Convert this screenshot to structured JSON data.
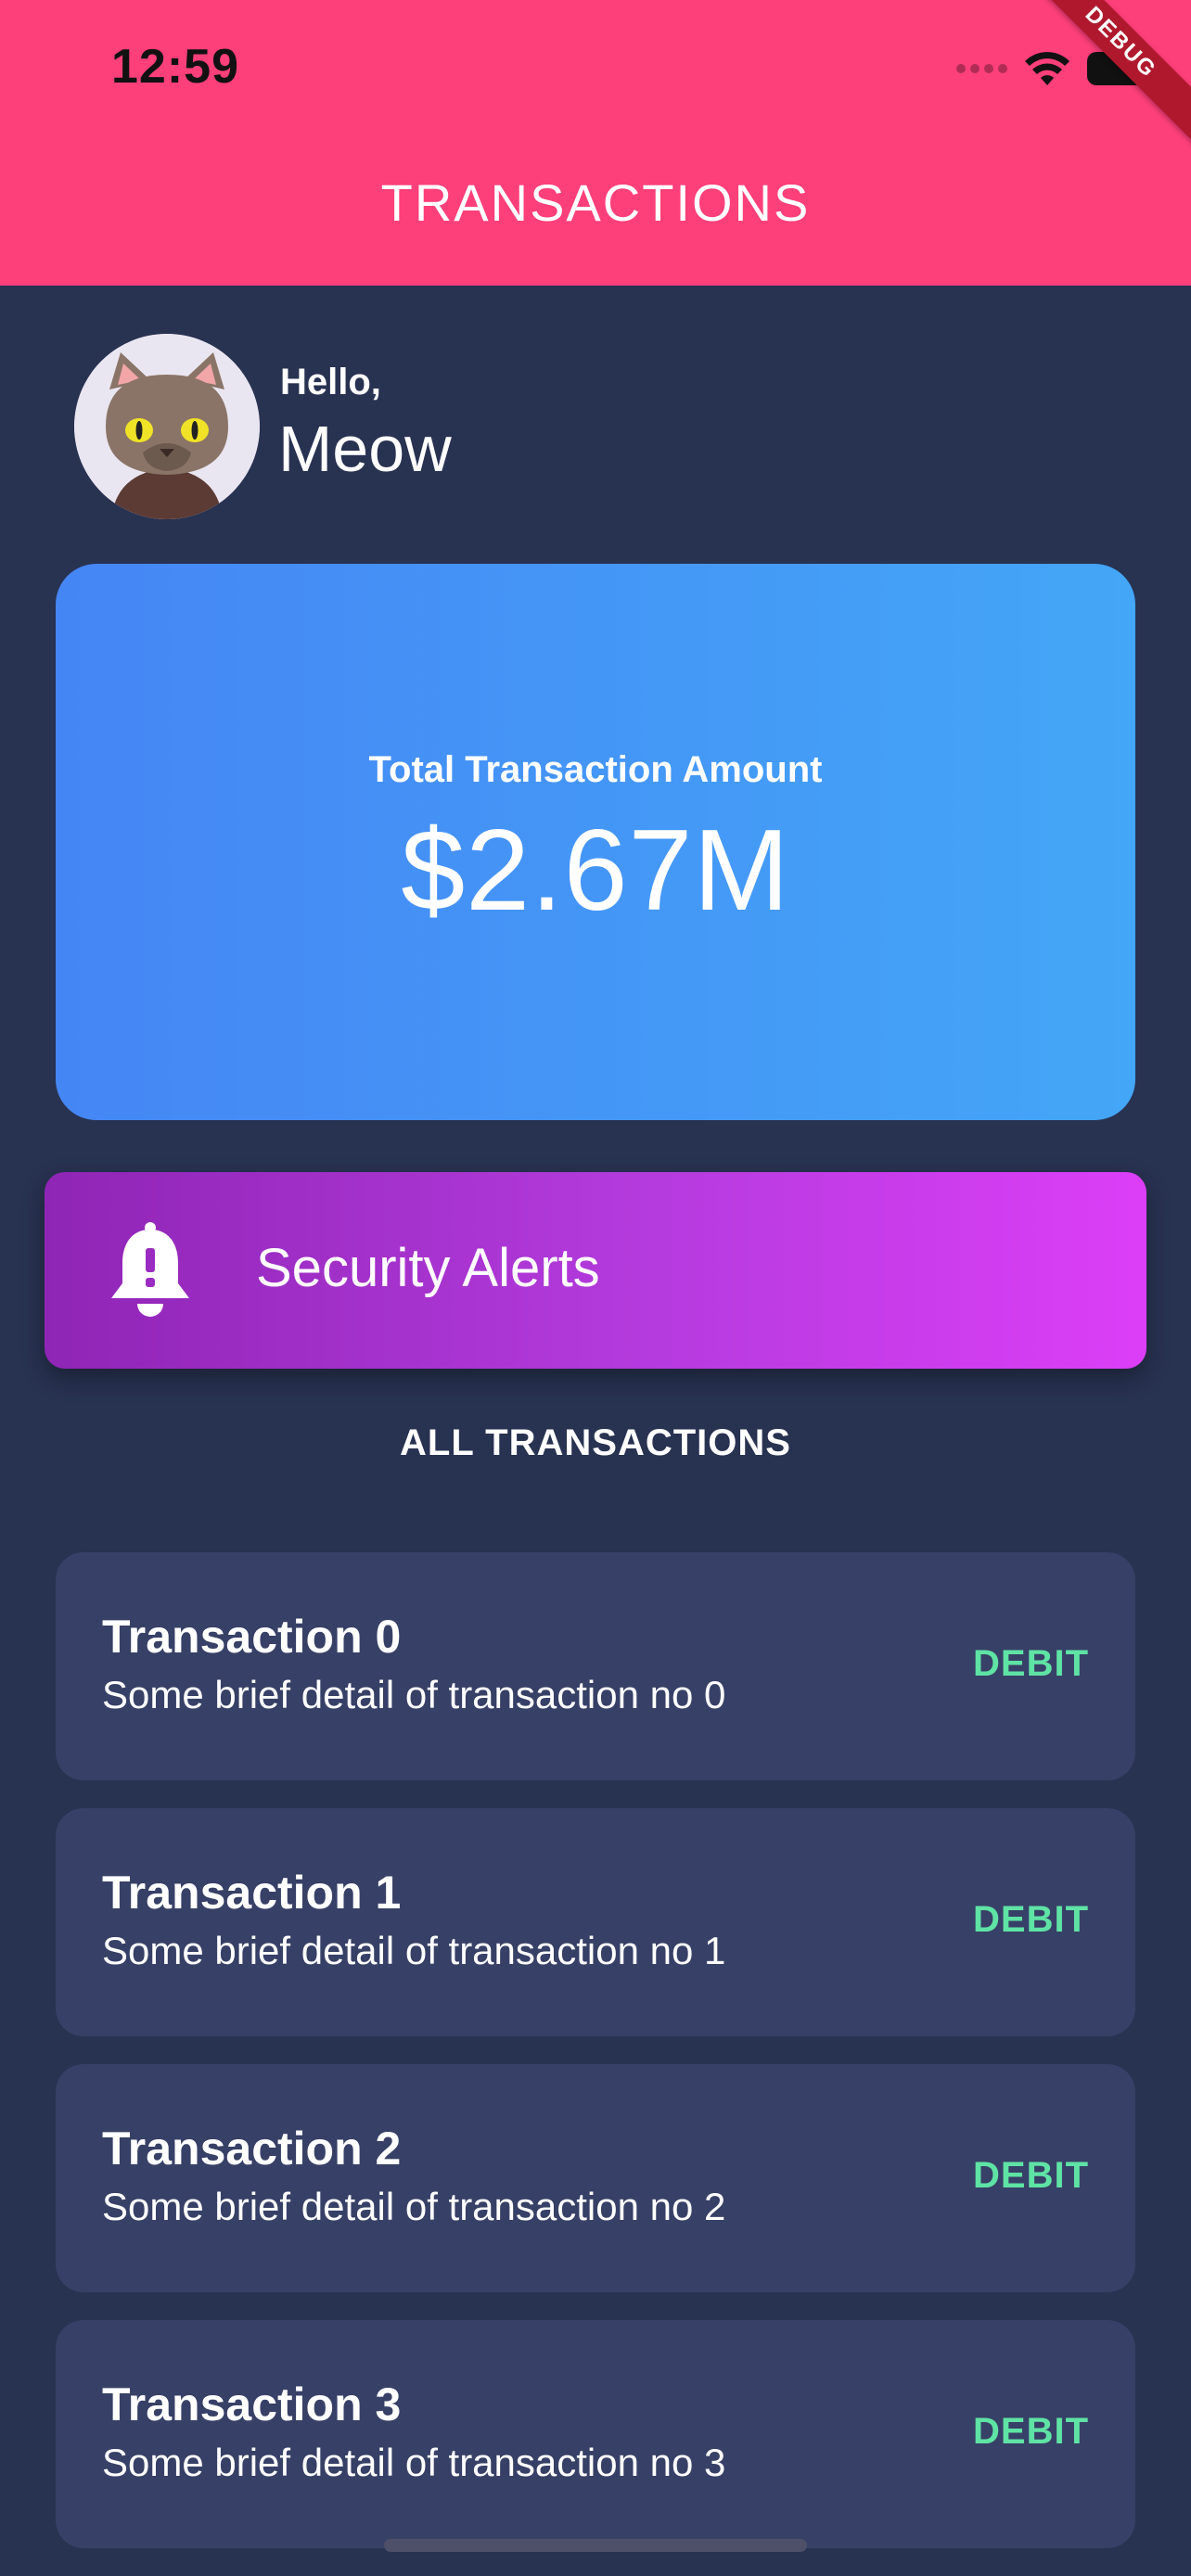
{
  "status_bar": {
    "time": "12:59",
    "debug_label": "DEBUG"
  },
  "app_bar": {
    "title": "TRANSACTIONS"
  },
  "greeting": {
    "hello": "Hello,",
    "name": "Meow"
  },
  "summary": {
    "label": "Total Transaction Amount",
    "amount": "$2.67M"
  },
  "alerts": {
    "label": "Security Alerts",
    "icon": "bell-alert-icon"
  },
  "section": {
    "title": "ALL TRANSACTIONS"
  },
  "transactions": [
    {
      "title": "Transaction 0",
      "detail": "Some brief detail of transaction no 0",
      "type": "DEBIT"
    },
    {
      "title": "Transaction 1",
      "detail": "Some brief detail of transaction no 1",
      "type": "DEBIT"
    },
    {
      "title": "Transaction 2",
      "detail": "Some brief detail of transaction no 2",
      "type": "DEBIT"
    },
    {
      "title": "Transaction 3",
      "detail": "Some brief detail of transaction no 3",
      "type": "DEBIT"
    }
  ],
  "colors": {
    "app_bar": "#fd3f7a",
    "background": "#283251",
    "card": "#374066",
    "debit": "#5fe3a5",
    "total_card_start": "#4586f5",
    "total_card_end": "#44a6f6",
    "alerts_start": "#8f25b5",
    "alerts_end": "#dc3ef7"
  }
}
